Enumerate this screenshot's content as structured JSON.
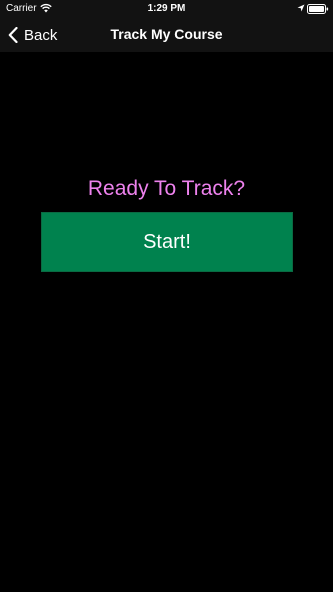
{
  "status_bar": {
    "carrier": "Carrier",
    "time": "1:29 PM",
    "icons": [
      "wifi-icon",
      "location-icon",
      "battery-icon"
    ]
  },
  "nav_bar": {
    "back_label": "Back",
    "title": "Track My Course"
  },
  "main": {
    "prompt": "Ready To Track?",
    "start_label": "Start!"
  },
  "colors": {
    "background": "#000000",
    "prompt_text": "#ee82ee",
    "start_button": "#00824e",
    "bar_background": "#121212"
  }
}
